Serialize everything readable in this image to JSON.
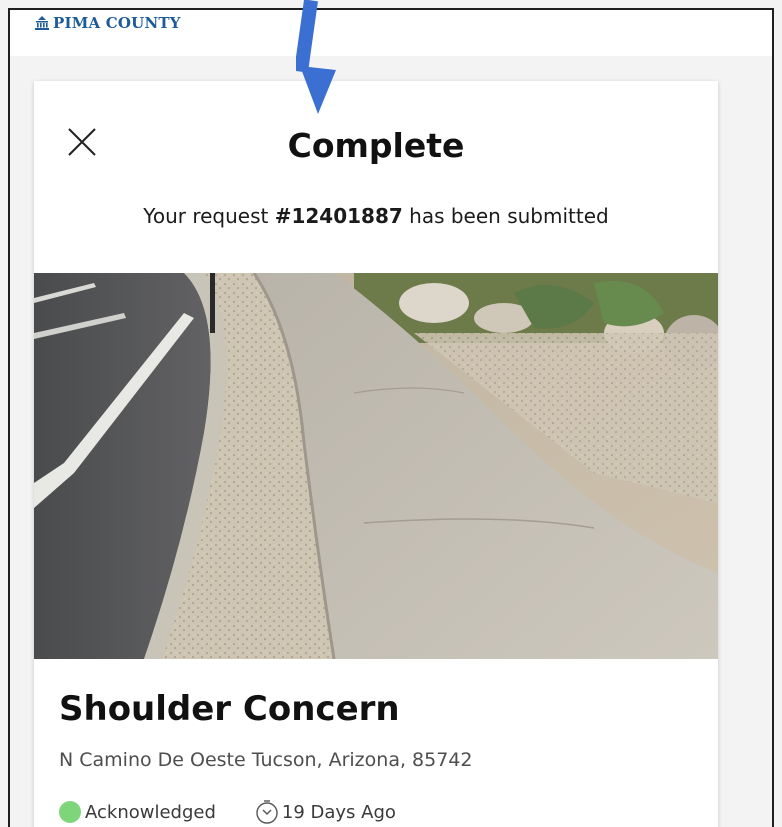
{
  "header": {
    "logo_text": "PIMA COUNTY",
    "brand_color": "#1d5b98"
  },
  "dialog": {
    "close_icon": "close-icon",
    "title": "Complete",
    "subtitle_prefix": "Your request ",
    "request_number": "#12401887",
    "subtitle_suffix": " has been submitted"
  },
  "request": {
    "photo": "sidewalk-photo",
    "title": "Shoulder Concern",
    "address": "N Camino De Oeste Tucson, Arizona, 85742",
    "status": "Acknowledged",
    "status_color": "#7fd67a",
    "age": "19 Days Ago"
  },
  "annotation": {
    "arrow_color": "#3b6fd1"
  }
}
